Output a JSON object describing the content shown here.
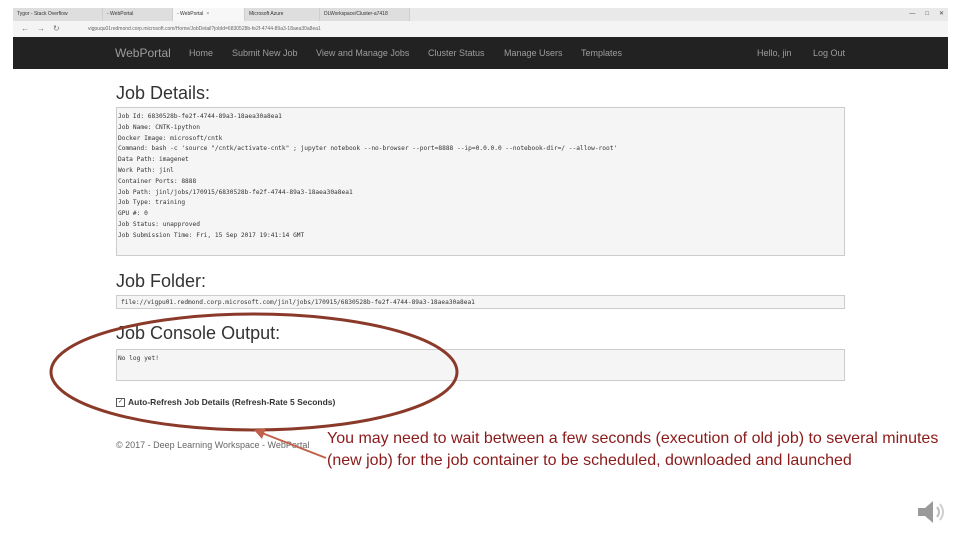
{
  "browser": {
    "tabs": [
      {
        "label": "Tygor - Stack Overflow",
        "active": false
      },
      {
        "label": "- WebPortal",
        "active": false
      },
      {
        "label": "- WebPortal",
        "active": true
      },
      {
        "label": "Microsoft Azure",
        "active": false
      },
      {
        "label": "DLWorkspace/Cluster-a7418",
        "active": false
      }
    ],
    "close_glyph": "×",
    "window_controls": [
      "—",
      "□",
      "✕"
    ],
    "address": "vigpuqu01redmond.corp.microsoft.com/Home/JobDetail?jobId=6830528b-fe2f-4744-89a3-18aea30a8ea1"
  },
  "navbar": {
    "brand": "WebPortal",
    "items": [
      "Home",
      "Submit New Job",
      "View and Manage Jobs",
      "Cluster Status",
      "Manage Users",
      "Templates"
    ],
    "greeting": "Hello, jin",
    "logout": "Log Out",
    "colors": {
      "background": "#222222",
      "text": "#9d9d9d"
    }
  },
  "job_details": {
    "heading": "Job Details:",
    "lines": [
      "Job Id: 6830528b-fe2f-4744-89a3-18aea30a8ea1",
      "Job Name: CNTK-ipython",
      "Docker Image: microsoft/cntk",
      "Command: bash -c 'source \"/cntk/activate-cntk\" ; jupyter notebook --no-browser --port=8888 --ip=0.0.0.0 --notebook-dir=/ --allow-root'",
      "Data Path: imagenet",
      "Work Path: jinl",
      "Container Ports: 8888",
      "Job Path: jinl/jobs/170915/6830528b-fe2f-4744-89a3-18aea30a8ea1",
      "Job Type: training",
      "GPU #: 0",
      "Job Status: unapproved",
      "Job Submission Time: Fri, 15 Sep 2017 19:41:14 GMT"
    ]
  },
  "job_folder": {
    "heading": "Job Folder:",
    "path": "file://vigpu01.redmond.corp.microsoft.com/jinl/jobs/170915/6830528b-fe2f-4744-89a3-18aea30a8ea1"
  },
  "console": {
    "heading": "Job Console Output:",
    "text": "No log yet!"
  },
  "auto_refresh": {
    "label": "Auto-Refresh Job Details (Refresh-Rate 5 Seconds)",
    "checked": true,
    "check_glyph": "✓"
  },
  "footer": "© 2017 - Deep Learning Workspace - WebPortal",
  "annotation": {
    "text": "You may need to wait between a few seconds (execution of old job) to several minutes (new job) for the job container to be scheduled, downloaded and launched",
    "ellipse_color": "#8b3a2a",
    "arrow_color": "#c0604a",
    "text_color": "#8b1a1a"
  },
  "icons": [
    "back-arrow-icon",
    "forward-arrow-icon",
    "refresh-icon",
    "speaker-icon"
  ]
}
